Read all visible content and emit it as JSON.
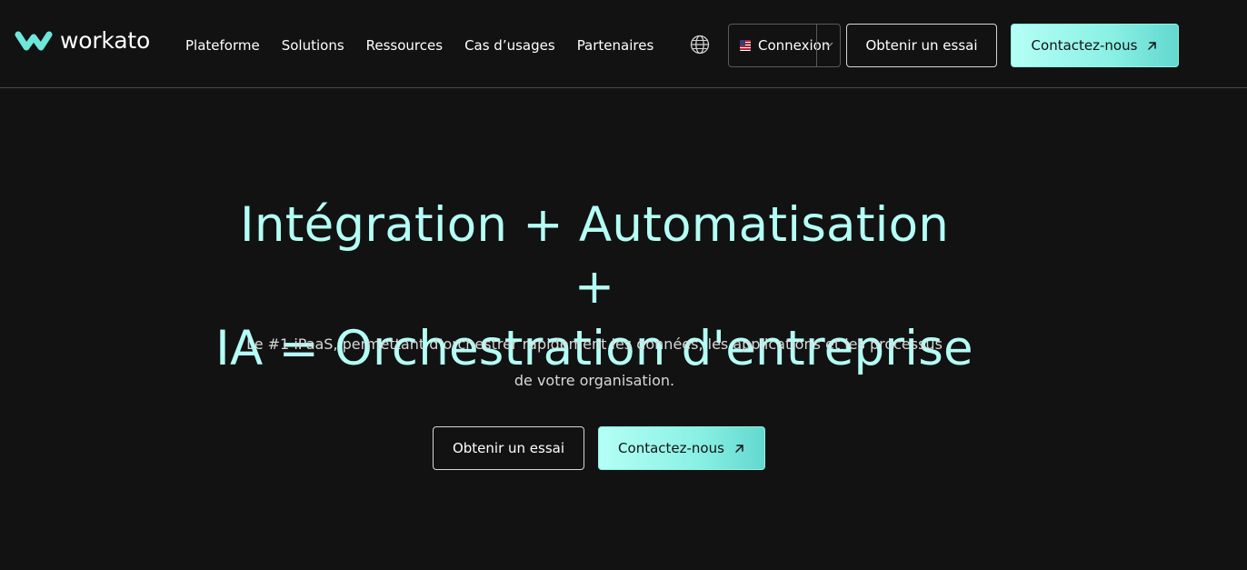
{
  "brand": {
    "name": "workato",
    "accent": "#b4fff6",
    "background": "#121212"
  },
  "nav": {
    "items": [
      {
        "label": "Plateforme"
      },
      {
        "label": "Solutions"
      },
      {
        "label": "Ressources"
      },
      {
        "label": "Cas d’usages"
      },
      {
        "label": "Partenaires"
      }
    ]
  },
  "header": {
    "globe_icon": "globe-icon",
    "language_select": {
      "flag_icon": "us-flag-icon",
      "label": "Connexion",
      "chevron_icon": "chevron-down-icon"
    },
    "trial_button": "Obtenir un essai",
    "contact_button": "Contactez-nous",
    "contact_icon": "arrow-up-right-icon"
  },
  "hero": {
    "title_line1": "Intégration + Automatisation +",
    "title_line2": "IA = Orchestration d'entreprise",
    "subtitle_line1": "Le #1 iPaaS, permettant d’orchestrer rapidement les données, les applications et les processus",
    "subtitle_line2": "de votre organisation.",
    "trial_button": "Obtenir un essai",
    "contact_button": "Contactez-nous",
    "contact_icon": "arrow-up-right-icon"
  }
}
